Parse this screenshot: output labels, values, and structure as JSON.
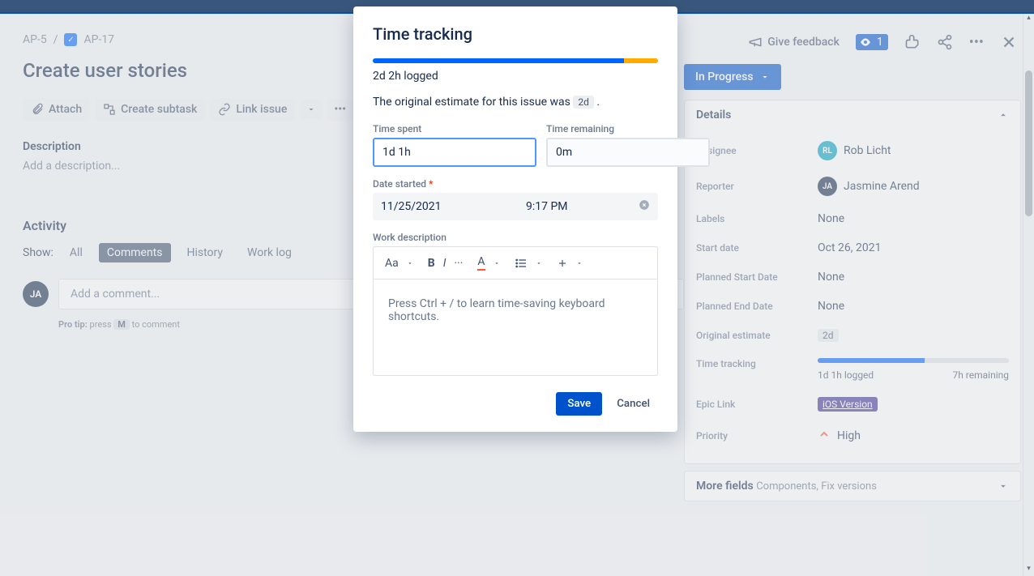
{
  "breadcrumb": {
    "parent": "AP-5",
    "current": "AP-17"
  },
  "issue": {
    "title": "Create user stories"
  },
  "toolbar": {
    "attach": "Attach",
    "create_subtask": "Create subtask",
    "link_issue": "Link issue"
  },
  "description": {
    "label": "Description",
    "placeholder": "Add a description..."
  },
  "activity": {
    "title": "Activity",
    "show_label": "Show:",
    "tabs": {
      "all": "All",
      "comments": "Comments",
      "history": "History",
      "worklog": "Work log"
    },
    "comment_placeholder": "Add a comment...",
    "avatar_initials": "JA",
    "protip_prefix": "Pro tip:",
    "protip_press": " press ",
    "protip_key": "M",
    "protip_suffix": " to comment"
  },
  "right": {
    "feedback": "Give feedback",
    "watch_count": "1",
    "status": "In Progress"
  },
  "details": {
    "header": "Details",
    "assignee_label": "Assignee",
    "assignee_value": "Rob Licht",
    "assignee_initials": "RL",
    "reporter_label": "Reporter",
    "reporter_value": "Jasmine Arend",
    "reporter_initials": "JA",
    "labels_label": "Labels",
    "labels_value": "None",
    "startdate_label": "Start date",
    "startdate_value": "Oct 26, 2021",
    "pstart_label": "Planned Start Date",
    "pstart_value": "None",
    "pend_label": "Planned End Date",
    "pend_value": "None",
    "origest_label": "Original estimate",
    "origest_value": "2d",
    "timetrack_label": "Time tracking",
    "timetrack_logged": "1d 1h logged",
    "timetrack_remaining": "7h remaining",
    "epic_label": "Epic Link",
    "epic_value": "iOS Version",
    "priority_label": "Priority",
    "priority_value": "High"
  },
  "morefields": {
    "title": "More fields",
    "extra": "Components, Fix versions"
  },
  "modal": {
    "title": "Time tracking",
    "logged": "2d 2h logged",
    "estimate_prefix": "The original estimate for this issue was ",
    "estimate_chip": "2d",
    "estimate_suffix": " .",
    "time_spent_label": "Time spent",
    "time_spent_value": "1d 1h",
    "time_remaining_label": "Time remaining",
    "time_remaining_value": "0m",
    "date_label": "Date started",
    "date_value": "11/25/2021",
    "time_value": "9:17 PM",
    "workdesc_label": "Work description",
    "editor_placeholder": "Press Ctrl + / to learn time-saving keyboard shortcuts.",
    "save": "Save",
    "cancel": "Cancel",
    "aa": "Aa"
  }
}
